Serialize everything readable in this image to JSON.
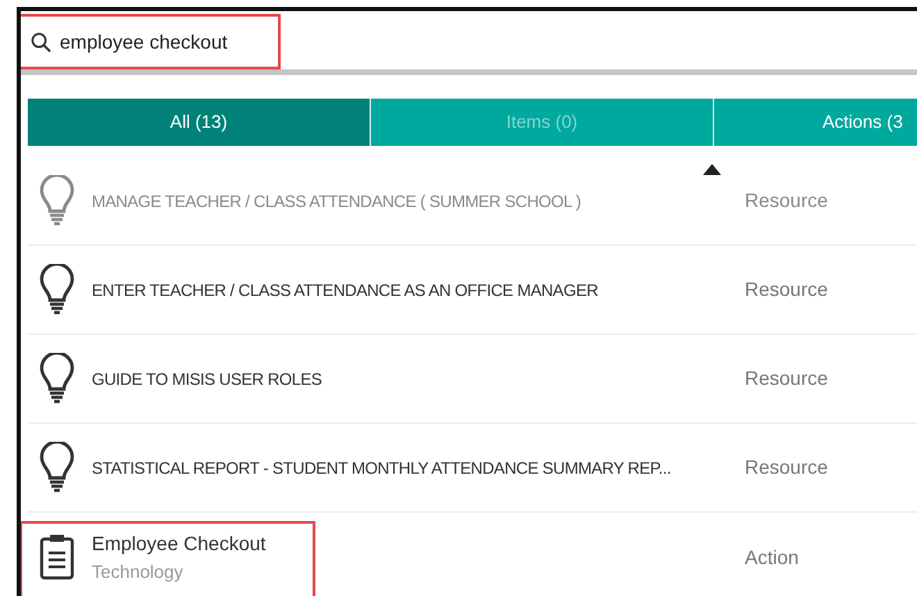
{
  "search": {
    "value": "employee checkout",
    "highlighted": true
  },
  "tabs": [
    {
      "label": "All (13)",
      "selected": true,
      "disabled": false
    },
    {
      "label": "Items (0)",
      "selected": false,
      "disabled": true
    },
    {
      "label": "Actions (3",
      "selected": false,
      "disabled": false
    }
  ],
  "results": [
    {
      "kind": "resource",
      "title": "MANAGE TEACHER / CLASS ATTENDANCE ( SUMMER SCHOOL )",
      "type": "Resource",
      "dimmed": true,
      "highlighted": false
    },
    {
      "kind": "resource",
      "title": "ENTER TEACHER / CLASS ATTENDANCE AS AN OFFICE MANAGER",
      "type": "Resource",
      "dimmed": false,
      "highlighted": false
    },
    {
      "kind": "resource",
      "title": "GUIDE TO MISIS USER ROLES",
      "type": "Resource",
      "dimmed": false,
      "highlighted": false
    },
    {
      "kind": "resource",
      "title": "STATISTICAL REPORT - STUDENT MONTHLY ATTENDANCE SUMMARY REP...",
      "type": "Resource",
      "dimmed": false,
      "highlighted": false
    },
    {
      "kind": "action",
      "title": "Employee Checkout",
      "subtitle": "Technology",
      "type": "Action",
      "dimmed": false,
      "highlighted": true
    }
  ]
}
